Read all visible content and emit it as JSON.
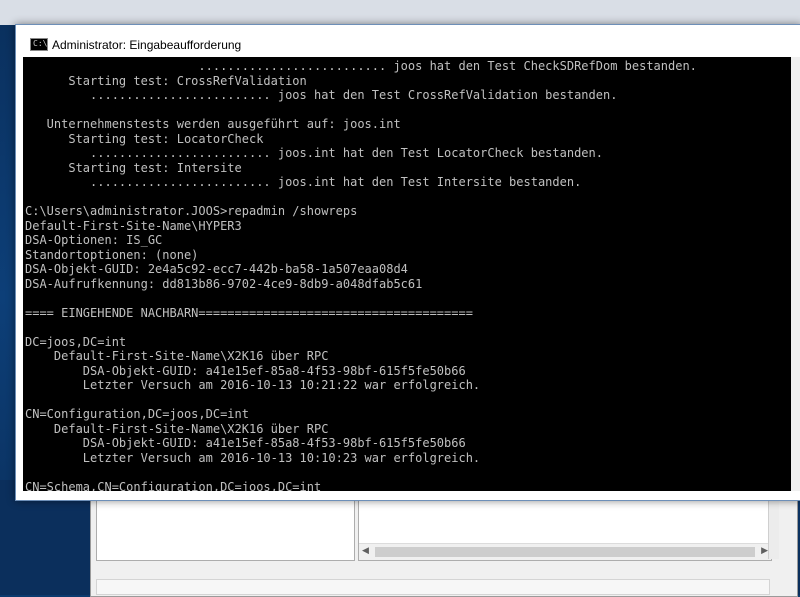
{
  "window": {
    "title": "Administrator: Eingabeaufforderung",
    "icon_label": "C:\\"
  },
  "console": {
    "lines": [
      "                        .......................... joos hat den Test CheckSDRefDom bestanden.",
      "      Starting test: CrossRefValidation",
      "         ......................... joos hat den Test CrossRefValidation bestanden.",
      "",
      "   Unternehmenstests werden ausgeführt auf: joos.int",
      "      Starting test: LocatorCheck",
      "         ......................... joos.int hat den Test LocatorCheck bestanden.",
      "      Starting test: Intersite",
      "         ......................... joos.int hat den Test Intersite bestanden.",
      "",
      "C:\\Users\\administrator.JOOS>repadmin /showreps",
      "Default-First-Site-Name\\HYPER3",
      "DSA-Optionen: IS_GC",
      "Standortoptionen: (none)",
      "DSA-Objekt-GUID: 2e4a5c92-ecc7-442b-ba58-1a507eaa08d4",
      "DSA-Aufrufkennung: dd813b86-9702-4ce9-8db9-a048dfab5c61",
      "",
      "==== EINGEHENDE NACHBARN======================================",
      "",
      "DC=joos,DC=int",
      "    Default-First-Site-Name\\X2K16 über RPC",
      "        DSA-Objekt-GUID: a41e15ef-85a8-4f53-98bf-615f5fe50b66",
      "        Letzter Versuch am 2016-10-13 10:21:22 war erfolgreich.",
      "",
      "CN=Configuration,DC=joos,DC=int",
      "    Default-First-Site-Name\\X2K16 über RPC",
      "        DSA-Objekt-GUID: a41e15ef-85a8-4f53-98bf-615f5fe50b66",
      "        Letzter Versuch am 2016-10-13 10:10:23 war erfolgreich.",
      "",
      "CN=Schema,CN=Configuration,DC=joos,DC=int"
    ]
  },
  "background_window": {
    "scroll_left_arrow": "◀",
    "scroll_right_arrow": "▶"
  }
}
